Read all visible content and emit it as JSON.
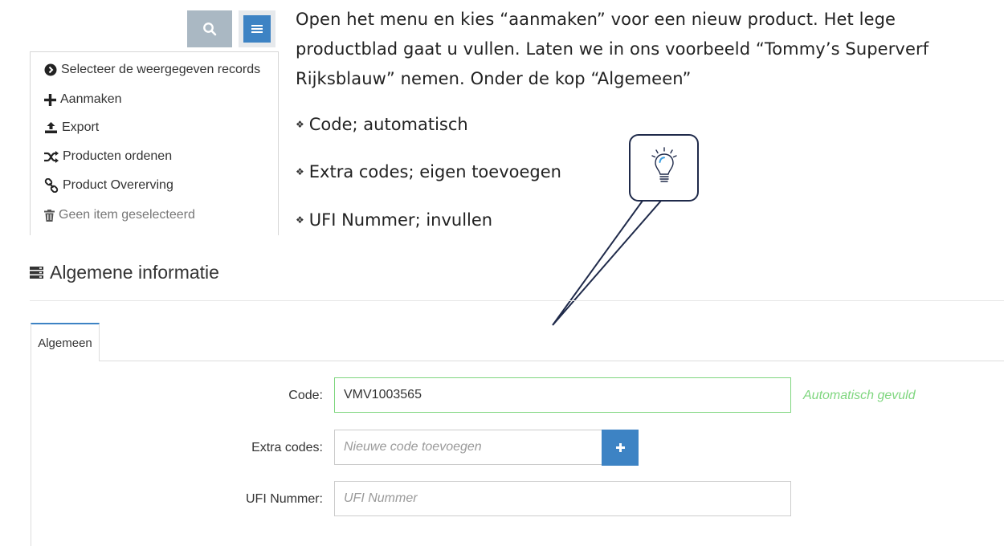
{
  "toolbar": {
    "search_icon": "search-icon",
    "menu_icon": "hamburger-icon"
  },
  "menu": {
    "items": [
      {
        "label": "Selecteer de weergegeven records",
        "icon": "chevron-circle-right-icon"
      },
      {
        "label": "Aanmaken",
        "icon": "plus-icon"
      },
      {
        "label": "Export",
        "icon": "export-icon"
      },
      {
        "label": "Producten ordenen",
        "icon": "shuffle-icon"
      },
      {
        "label": "Product Overerving",
        "icon": "link-icon"
      },
      {
        "label": "Geen item geselecteerd",
        "icon": "trash-icon",
        "disabled": true
      }
    ]
  },
  "instructions": {
    "paragraph": "Open het menu en kies “aanmaken” voor een nieuw product. Het lege productblad gaat u vullen. Laten we in ons voorbeeld “Tommy’s Superverf Rijksblauw” nemen. Onder de kop “Algemeen”",
    "bullets": [
      "Code; automatisch",
      "Extra codes; eigen toevoegen",
      "UFI Nummer; invullen"
    ]
  },
  "section": {
    "title": "Algemene informatie",
    "icon": "server-icon"
  },
  "tabs": [
    {
      "label": "Algemeen",
      "active": true
    }
  ],
  "form": {
    "code": {
      "label": "Code:",
      "value": "VMV1003565",
      "hint": "Automatisch gevuld"
    },
    "extra_codes": {
      "label": "Extra codes:",
      "placeholder": "Nieuwe code toevoegen"
    },
    "ufi": {
      "label": "UFI Nummer:",
      "placeholder": "UFI Nummer"
    }
  },
  "colors": {
    "accent": "#3d83c4",
    "success": "#7fd67f",
    "search_button": "#aab8c3",
    "callout_border": "#1f2a4a"
  }
}
